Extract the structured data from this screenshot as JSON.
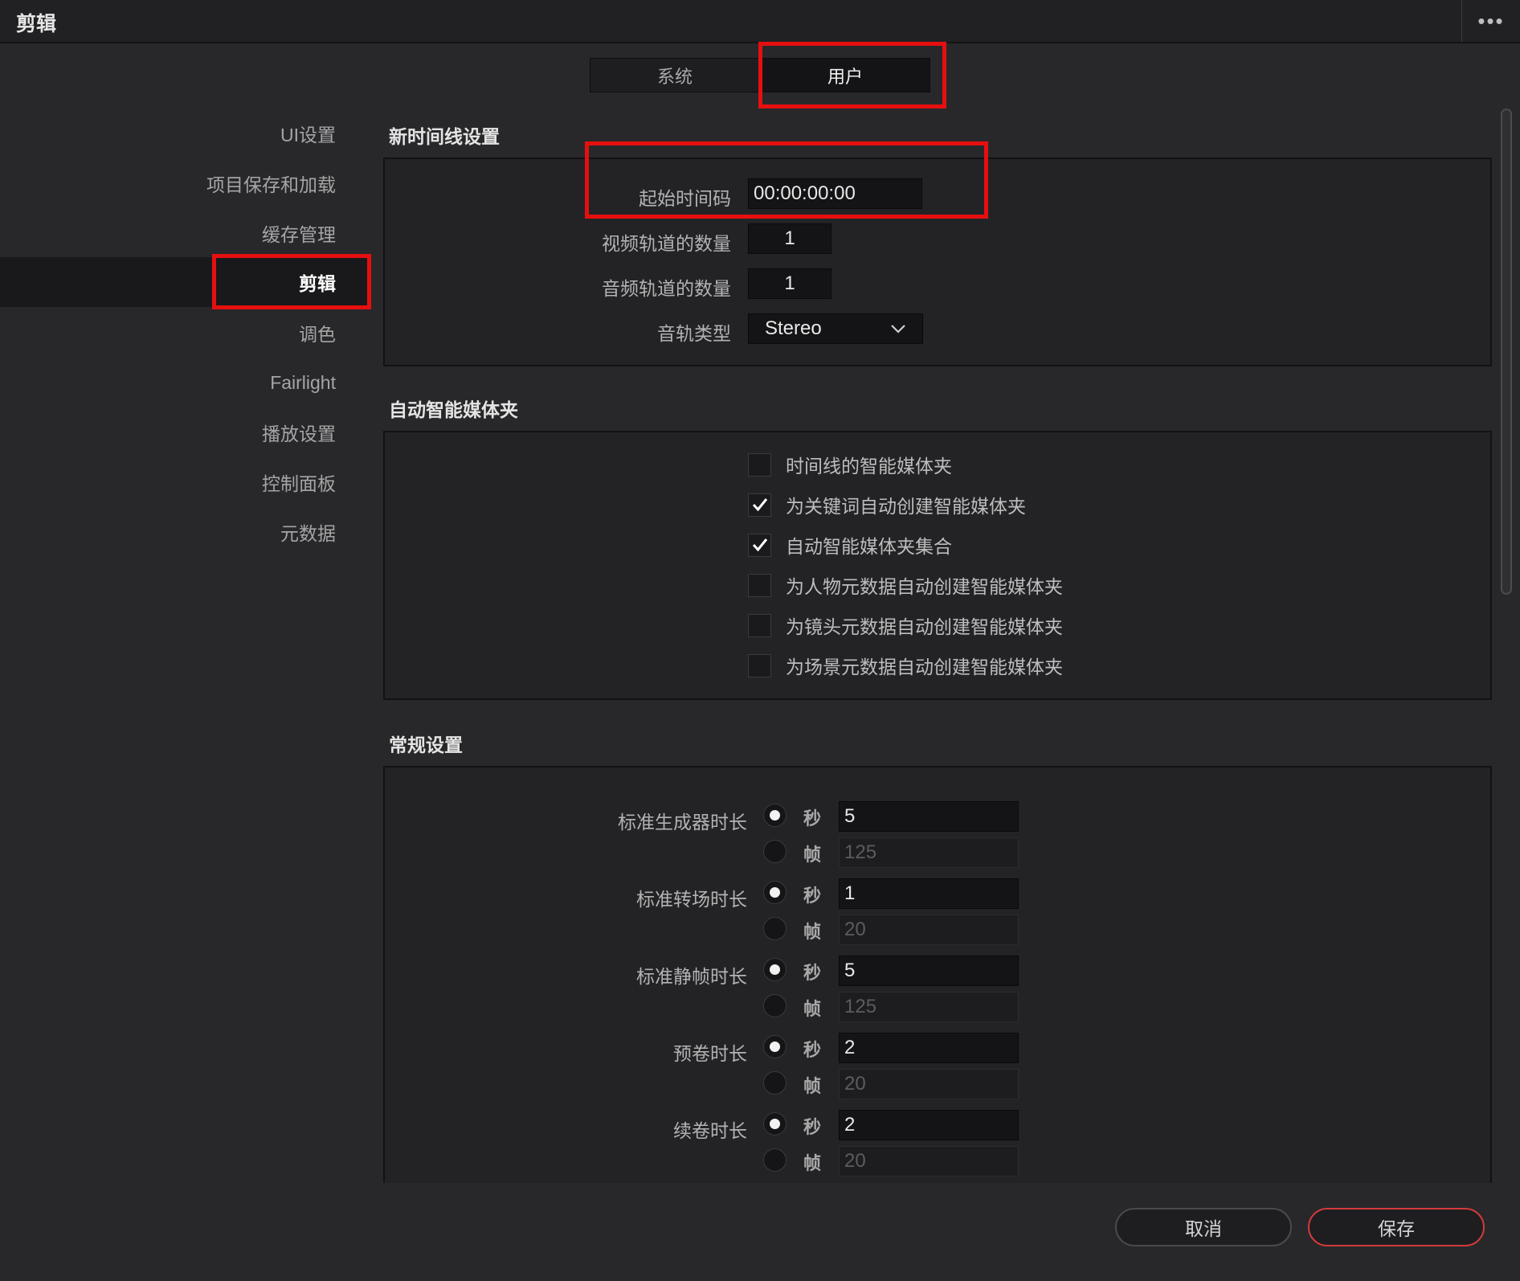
{
  "window": {
    "title": "剪辑",
    "menu_icon": "more-dots-icon"
  },
  "tabs": [
    {
      "label": "系统",
      "active": false
    },
    {
      "label": "用户",
      "active": true
    }
  ],
  "sidebar": {
    "items": [
      {
        "label": "UI设置"
      },
      {
        "label": "项目保存和加载"
      },
      {
        "label": "缓存管理"
      },
      {
        "label": "剪辑",
        "active": true
      },
      {
        "label": "调色"
      },
      {
        "label": "Fairlight"
      },
      {
        "label": "播放设置"
      },
      {
        "label": "控制面板"
      },
      {
        "label": "元数据"
      }
    ]
  },
  "timeline_settings": {
    "title": "新时间线设置",
    "start_timecode_label": "起始时间码",
    "start_timecode": "00:00:00:00",
    "video_tracks_label": "视频轨道的数量",
    "video_tracks": "1",
    "audio_tracks_label": "音频轨道的数量",
    "audio_tracks": "1",
    "audio_type_label": "音轨类型",
    "audio_type": "Stereo"
  },
  "smart_bins": {
    "title": "自动智能媒体夹",
    "items": [
      {
        "label": "时间线的智能媒体夹",
        "checked": false
      },
      {
        "label": "为关键词自动创建智能媒体夹",
        "checked": true
      },
      {
        "label": "自动智能媒体夹集合",
        "checked": true
      },
      {
        "label": "为人物元数据自动创建智能媒体夹",
        "checked": false
      },
      {
        "label": "为镜头元数据自动创建智能媒体夹",
        "checked": false
      },
      {
        "label": "为场景元数据自动创建智能媒体夹",
        "checked": false
      }
    ]
  },
  "general": {
    "title": "常规设置",
    "unit_seconds": "秒",
    "unit_frames": "帧",
    "rows": [
      {
        "label": "标准生成器时长",
        "seconds": "5",
        "frames": "125"
      },
      {
        "label": "标准转场时长",
        "seconds": "1",
        "frames": "20"
      },
      {
        "label": "标准静帧时长",
        "seconds": "5",
        "frames": "125"
      },
      {
        "label": "预卷时长",
        "seconds": "2",
        "frames": "20"
      },
      {
        "label": "续卷时长",
        "seconds": "2",
        "frames": "20"
      }
    ]
  },
  "footer": {
    "cancel": "取消",
    "save": "保存"
  },
  "colors": {
    "highlight": "#e60f0f",
    "save_border": "#d23a3a"
  }
}
